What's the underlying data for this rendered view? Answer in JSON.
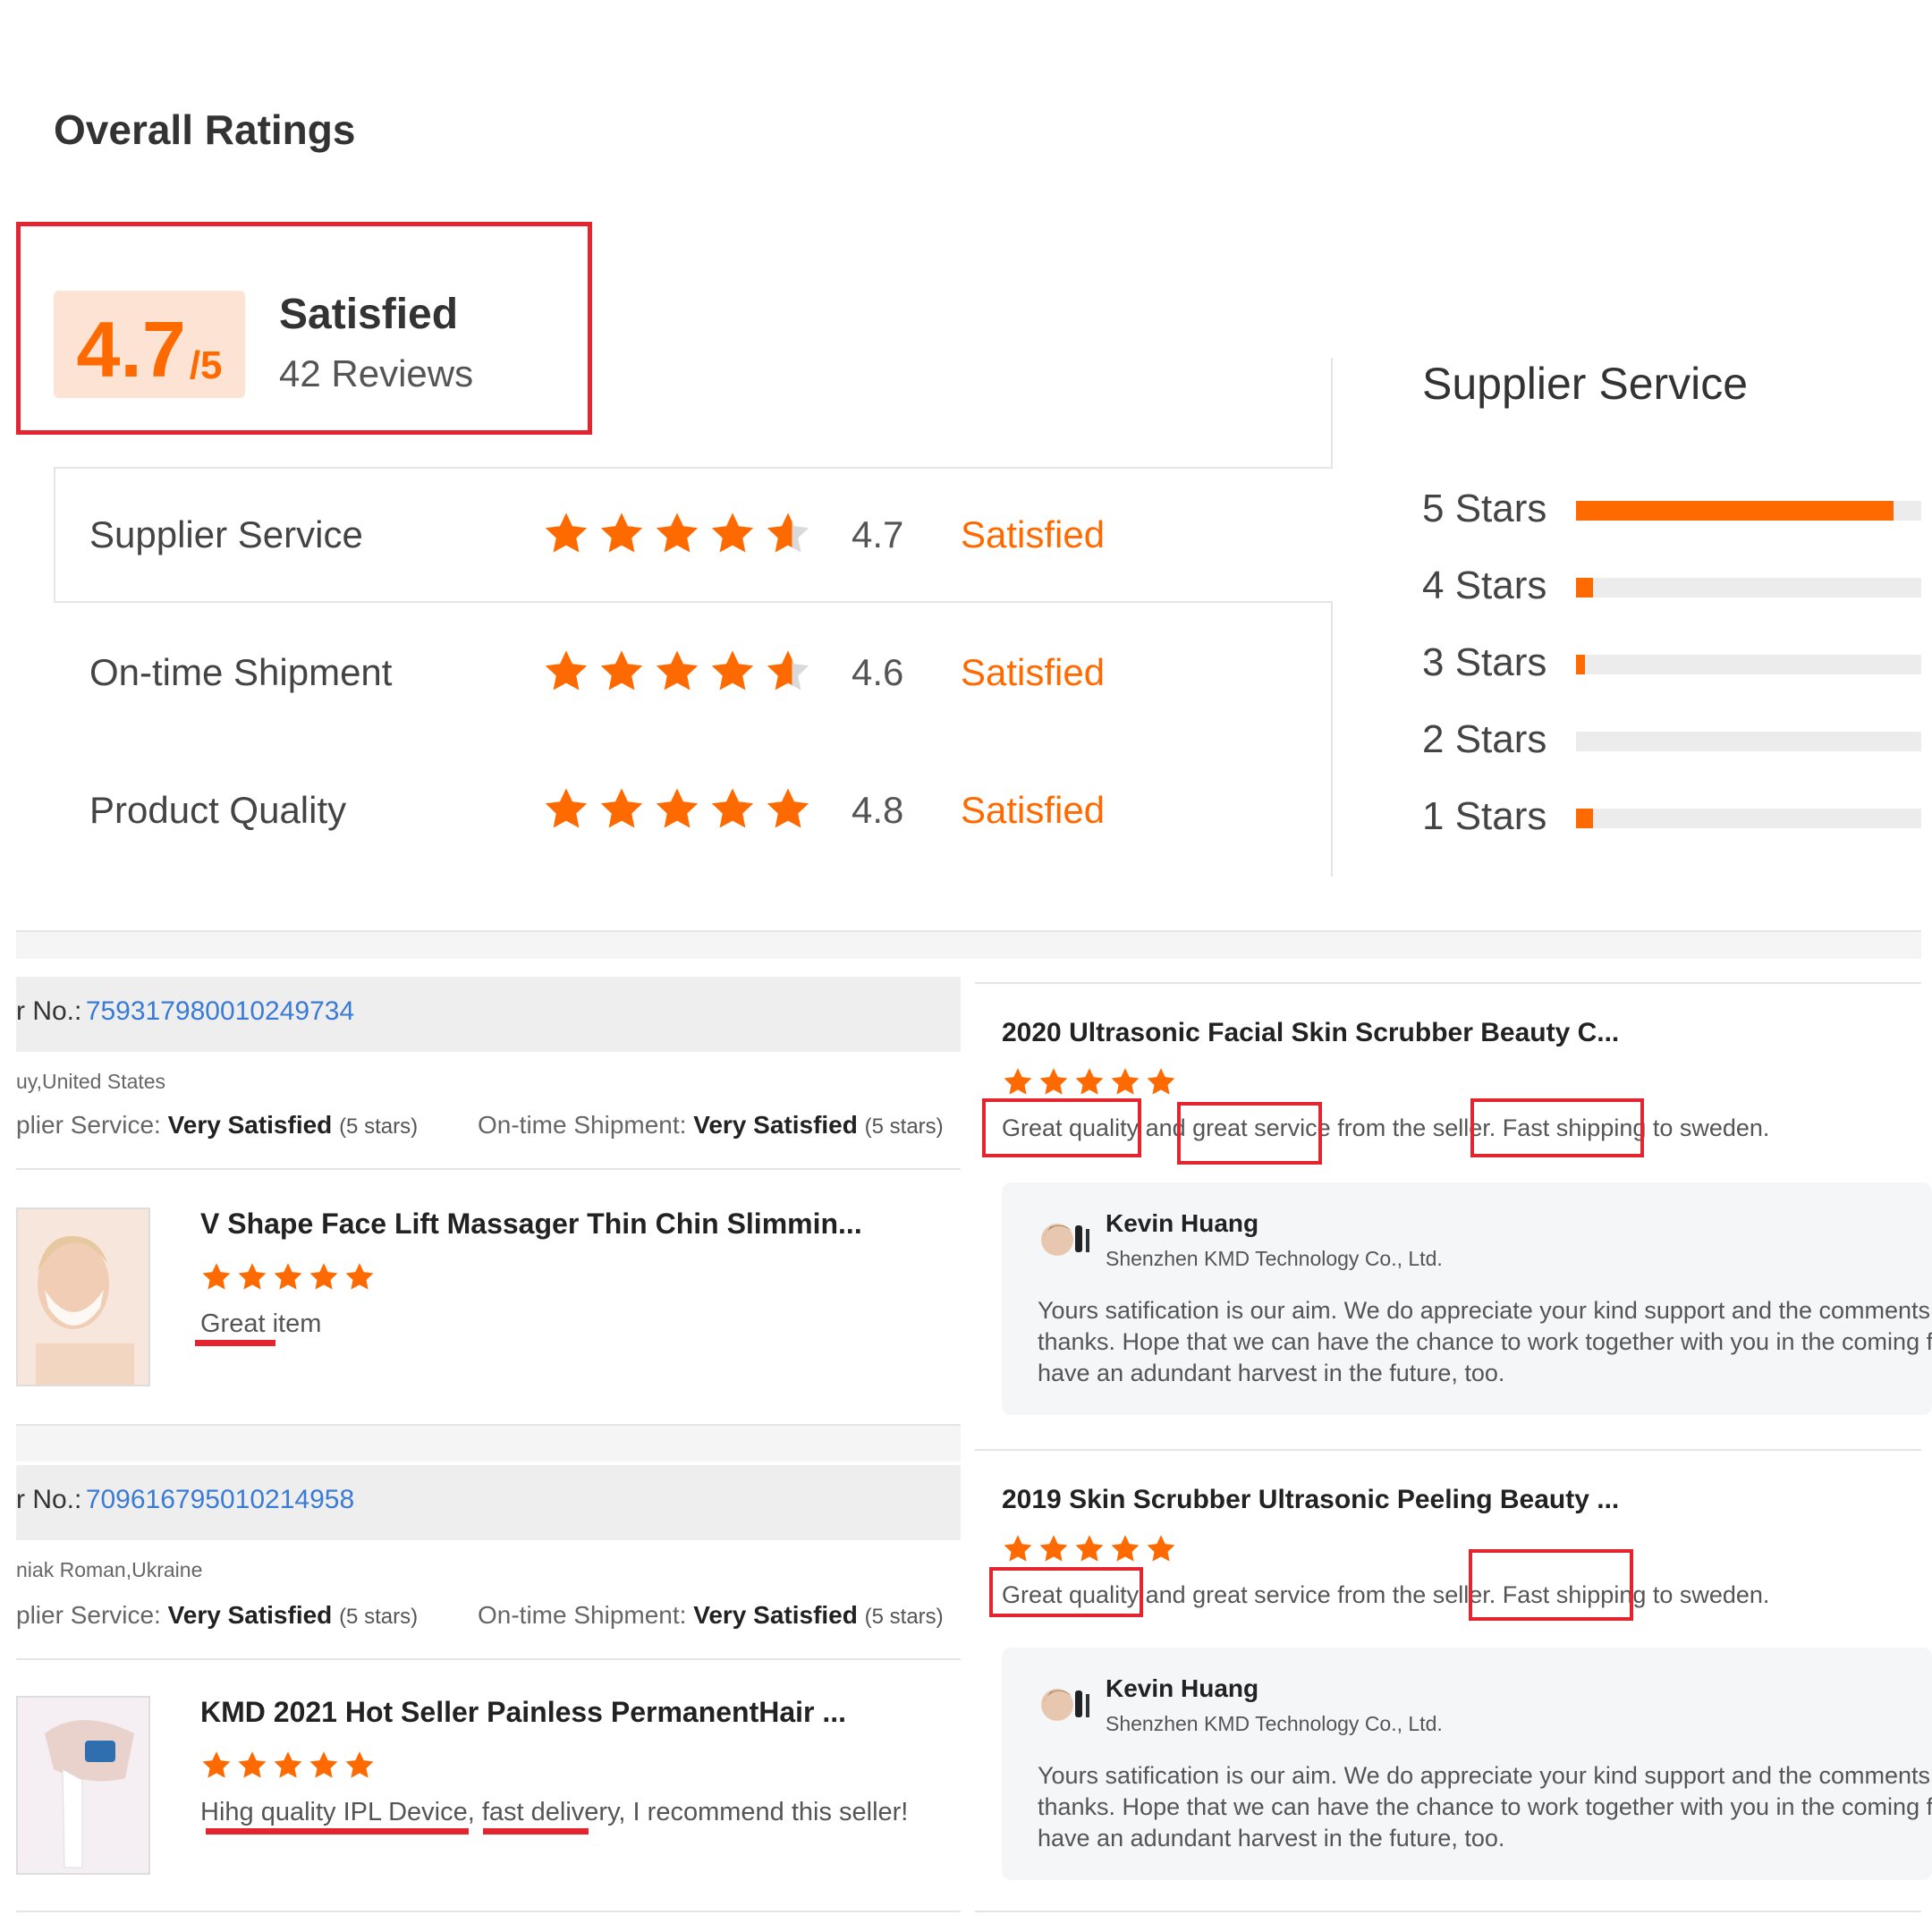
{
  "page_title": "Overall Ratings",
  "score": {
    "value": "4.7",
    "scale": "/5",
    "word": "Satisfied",
    "reviews": "42 Reviews"
  },
  "categories": [
    {
      "label": "Supplier Service",
      "stars": 4.7,
      "value": "4.7",
      "word": "Satisfied"
    },
    {
      "label": "On-time Shipment",
      "stars": 4.6,
      "value": "4.6",
      "word": "Satisfied"
    },
    {
      "label": "Product Quality",
      "stars": 4.8,
      "value": "4.8",
      "word": "Satisfied"
    }
  ],
  "distribution": {
    "title": "Supplier Service",
    "rows": [
      {
        "label": "5  Stars",
        "fill": 0.92
      },
      {
        "label": "4  Stars",
        "fill": 0.05
      },
      {
        "label": "3  Stars",
        "fill": 0.025
      },
      {
        "label": "2  Stars",
        "fill": 0
      },
      {
        "label": "1  Stars",
        "fill": 0.05
      }
    ]
  },
  "colors": {
    "accent": "#ff6a00",
    "highlight": "#e4242f",
    "link": "#3a7bd5"
  },
  "orders": [
    {
      "order_label": "r No.:",
      "order_number": "759317980010249734",
      "buyer": "uy,United States",
      "supplier_service_label": "plier Service:",
      "supplier_service_value": "Very Satisfied",
      "supplier_service_stars": "(5 stars)",
      "shipment_label": "On-time Shipment:",
      "shipment_value": "Very Satisfied",
      "shipment_stars": "(5 stars)",
      "product_title": "V Shape Face Lift Massager Thin Chin Slimmin...",
      "review": "Great item",
      "thumb_icon": "face-lift-mask-product-image"
    },
    {
      "order_label": "r No.:",
      "order_number": "709616795010214958",
      "buyer": "niak Roman,Ukraine",
      "supplier_service_label": "plier Service:",
      "supplier_service_value": "Very Satisfied",
      "supplier_service_stars": "(5 stars)",
      "shipment_label": "On-time Shipment:",
      "shipment_value": "Very Satisfied",
      "shipment_stars": "(5 stars)",
      "product_title": "KMD 2021 Hot Seller Painless PermanentHair ...",
      "review": "Hihg quality IPL Device, fast delivery, I recommend this seller!",
      "thumb_icon": "ipl-hair-removal-device-image"
    }
  ],
  "reviews": [
    {
      "product_title": "2020 Ultrasonic Facial Skin Scrubber Beauty C...",
      "text": "Great quality and great service from the seller. Fast shipping to sweden.",
      "reply_name": "Kevin Huang",
      "reply_company": "Shenzhen KMD Technology Co., Ltd.",
      "reply_text": "Yours satification is our aim. We do appreciate your kind support and the comments c",
      "reply_text_2": "thanks. Hope that we can have the chance to work together with you in the coming fu",
      "reply_text_3": "have an adundant harvest in the future, too."
    },
    {
      "product_title": "2019 Skin Scrubber Ultrasonic Peeling Beauty ...",
      "text": "Great quality and great service from the seller. Fast shipping to sweden.",
      "reply_name": "Kevin Huang",
      "reply_company": "Shenzhen KMD Technology Co., Ltd.",
      "reply_text": "Yours satification is our aim. We do appreciate your kind support and the comments c",
      "reply_text_2": "thanks. Hope that we can have the chance to work together with you in the coming fu",
      "reply_text_3": "have an adundant harvest in the future, too."
    }
  ]
}
